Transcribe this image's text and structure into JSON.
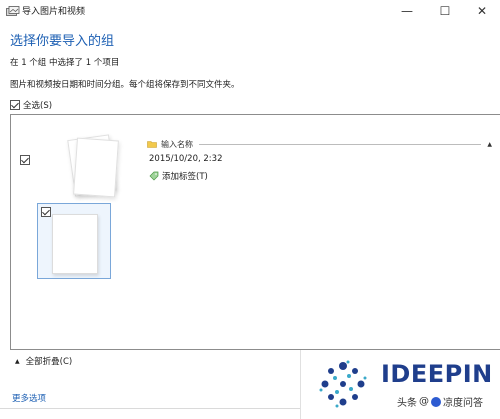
{
  "window": {
    "title": "导入图片和视频",
    "buttons": {
      "minimize": "—",
      "maximize": "☐",
      "close": "✕"
    }
  },
  "main": {
    "heading": "选择你要导入的组",
    "selection_summary": "在 1 个组 中选择了 1 个项目",
    "description": "图片和视频按日期和时间分组。每个组将保存到不同文件夹。",
    "select_all_label": "全选(S)",
    "select_all_checked": true
  },
  "group": {
    "checked": true,
    "name_placeholder": "输入名称",
    "date": "2015/10/20, 2:32",
    "add_tag_label": "添加标签(T)",
    "items": [
      {
        "checked": true
      }
    ]
  },
  "footer": {
    "collapse_all_label": "全部折叠(C)",
    "more_options_label": "更多选项"
  },
  "watermark": {
    "brand": "IDEEPIN",
    "credit_source": "头条",
    "credit_at": "@",
    "credit_name": "凉度问答"
  },
  "colors": {
    "accent": "#1c5fb3",
    "selected_tile_border": "#7aa7d9",
    "selected_tile_bg": "#eef5fd",
    "brand": "#1f3e8c"
  }
}
